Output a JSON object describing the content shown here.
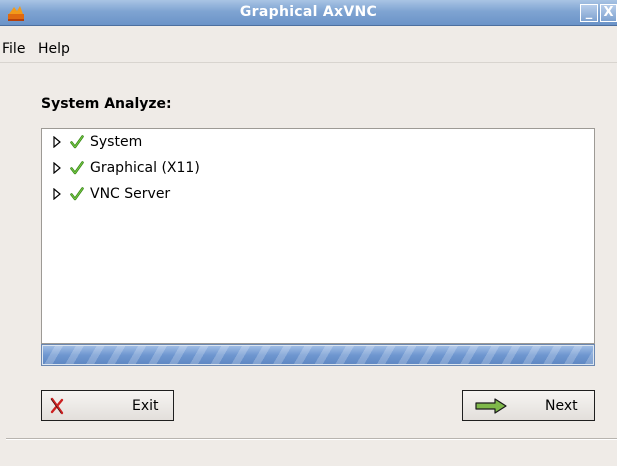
{
  "window": {
    "title": "Graphical AxVNC",
    "icons": {
      "app": "app-logo-icon",
      "minimize": "minimize-icon",
      "close": "close-icon"
    },
    "minimize_glyph": "_",
    "close_glyph": "X"
  },
  "menubar": {
    "items": [
      {
        "label": "File"
      },
      {
        "label": "Help"
      }
    ]
  },
  "main": {
    "section_label": "System Analyze:",
    "tree": {
      "items": [
        {
          "label": "System",
          "status": "check-icon",
          "expanded": false
        },
        {
          "label": "Graphical (X11)",
          "status": "check-icon",
          "expanded": false
        },
        {
          "label": "VNC Server",
          "status": "check-icon",
          "expanded": false
        }
      ]
    },
    "progress": {
      "fraction": 1.0
    }
  },
  "buttons": {
    "exit": {
      "label": "Exit",
      "icon": "x-mark-icon"
    },
    "next": {
      "label": "Next",
      "icon": "right-arrow-icon"
    }
  },
  "colors": {
    "titlebar": "#7fa4d2",
    "progress": "#6f97d0",
    "check": "#3a8a1a",
    "exit_icon": "#cc2020"
  }
}
